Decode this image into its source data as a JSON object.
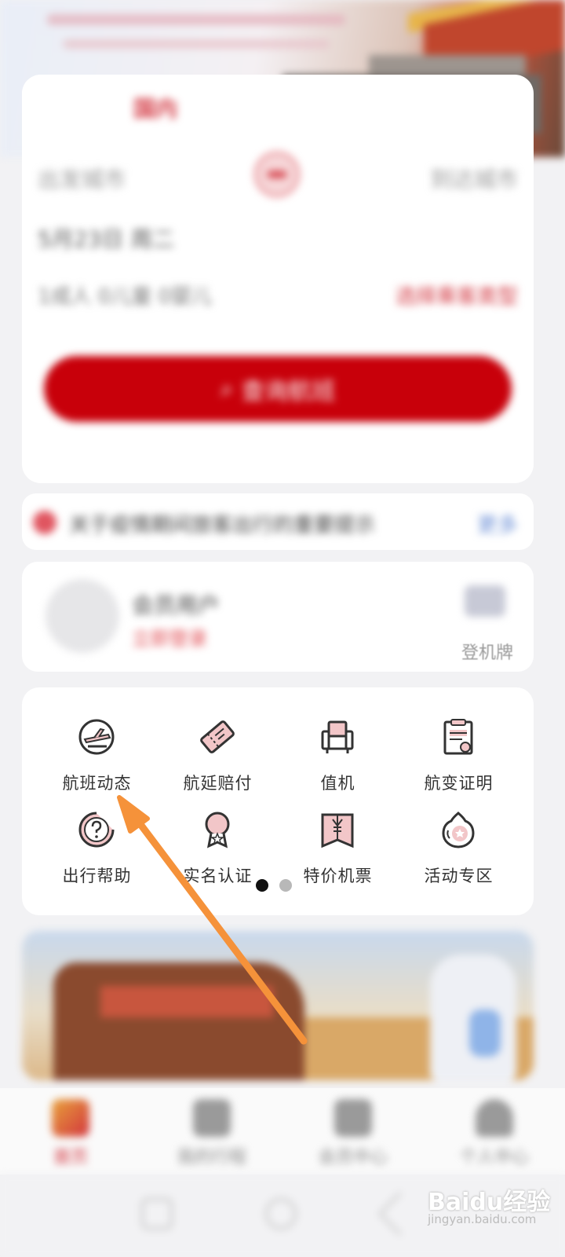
{
  "hero": {},
  "search": {
    "tab_label": "国内",
    "from_city": "出发城市",
    "to_city": "到达城市",
    "date": "5月23日 周二",
    "passengers": "1成人 0儿童 0婴儿",
    "passenger_link": "选择乘客类型",
    "search_button": "查询航班"
  },
  "notice": {
    "text": "关于疫情期间旅客出行的重要提示",
    "more": "更多"
  },
  "member": {
    "name": "会员用户",
    "login": "立即登录",
    "boarding_pass": "登机牌"
  },
  "menu": {
    "items": [
      {
        "label": "航班动态",
        "icon": "flight-status-icon"
      },
      {
        "label": "航延赔付",
        "icon": "delay-compensation-icon"
      },
      {
        "label": "值机",
        "icon": "check-in-icon"
      },
      {
        "label": "航变证明",
        "icon": "flight-change-certificate-icon"
      },
      {
        "label": "出行帮助",
        "icon": "travel-help-icon"
      },
      {
        "label": "实名认证",
        "icon": "real-name-auth-icon"
      },
      {
        "label": "特价机票",
        "icon": "special-fare-icon"
      },
      {
        "label": "活动专区",
        "icon": "events-icon"
      }
    ],
    "pages": 2,
    "current_page": 1
  },
  "bottom_nav": {
    "items": [
      {
        "label": "首页",
        "active": true
      },
      {
        "label": "我的行程",
        "active": false
      },
      {
        "label": "会员中心",
        "active": false
      },
      {
        "label": "个人中心",
        "active": false
      }
    ]
  },
  "watermark": {
    "text": "Baidu经验",
    "sub": "jingyan.baidu.com"
  },
  "colors": {
    "brand_red": "#c8000a",
    "accent_pink": "#f2c6c8",
    "annotation_arrow": "#f5923a"
  }
}
